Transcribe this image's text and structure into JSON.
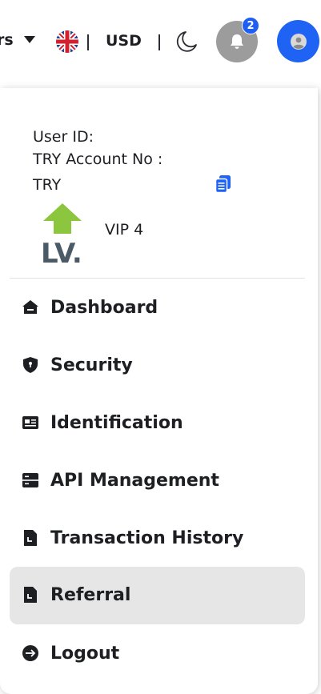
{
  "header": {
    "orders_partial": "rs",
    "currency": "USD",
    "notification_count": "2",
    "brand_color": "#1f63f5",
    "icons": [
      "chevron-down-icon",
      "uk-flag-icon",
      "moon-icon",
      "bell-icon",
      "user-icon"
    ]
  },
  "account": {
    "user_id_label": "User ID:",
    "account_no_label": "TRY Account No :",
    "currency_code": "TRY",
    "vip_level": "VIP 4",
    "vip_logo_text": "LV."
  },
  "menu": {
    "items": [
      {
        "label": "Dashboard",
        "icon": "home-icon",
        "active": false
      },
      {
        "label": "Security",
        "icon": "shield-icon",
        "active": false
      },
      {
        "label": "Identification",
        "icon": "id-card-icon",
        "active": false
      },
      {
        "label": "API Management",
        "icon": "server-icon",
        "active": false
      },
      {
        "label": "Transaction History",
        "icon": "document-icon",
        "active": false
      },
      {
        "label": "Referral",
        "icon": "document-icon",
        "active": true
      },
      {
        "label": "Logout",
        "icon": "logout-icon",
        "active": false
      }
    ]
  }
}
